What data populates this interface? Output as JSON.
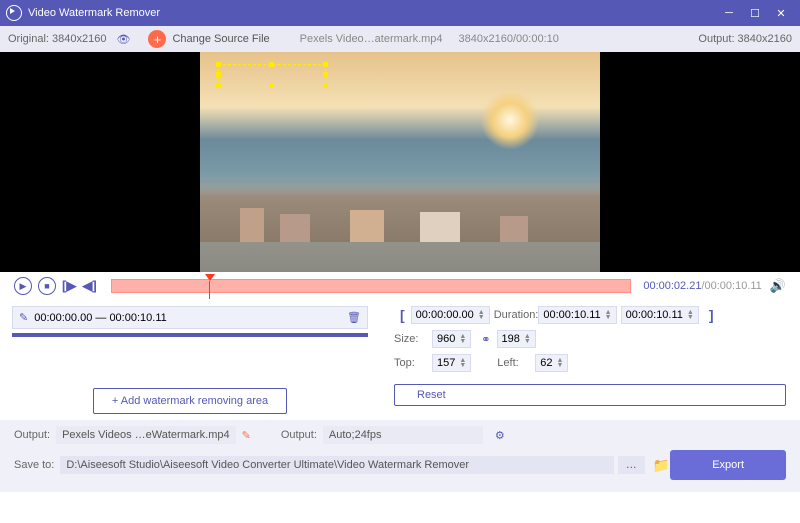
{
  "titlebar": {
    "title": "Video Watermark Remover"
  },
  "infobar": {
    "original": "Original: 3840x2160",
    "change_source": "Change Source File",
    "filename": "Pexels Video…atermark.mp4",
    "resolution": "3840x2160/00:00:10",
    "output": "Output: 3840x2160"
  },
  "timecode": {
    "current": "00:00:02.21",
    "total": "/00:00:10.11"
  },
  "segment": {
    "range": "00:00:00.00 — 00:00:10.11"
  },
  "add_area": "+  Add watermark removing area",
  "range": {
    "start": "00:00:00.00",
    "dur_label": "Duration:",
    "dur_value": "00:00:10.11",
    "end": "00:00:10.11"
  },
  "dims": {
    "size_label": "Size:",
    "w": "960",
    "h": "198",
    "top_label": "Top:",
    "top": "157",
    "left_label": "Left:",
    "left": "62"
  },
  "reset": "Reset",
  "bottom": {
    "out_label": "Output:",
    "out_file": "Pexels Videos …eWatermark.mp4",
    "out2_label": "Output:",
    "out2_value": "Auto;24fps",
    "save_label": "Save to:",
    "save_path": "D:\\Aiseesoft Studio\\Aiseesoft Video Converter Ultimate\\Video Watermark Remover",
    "export": "Export"
  }
}
